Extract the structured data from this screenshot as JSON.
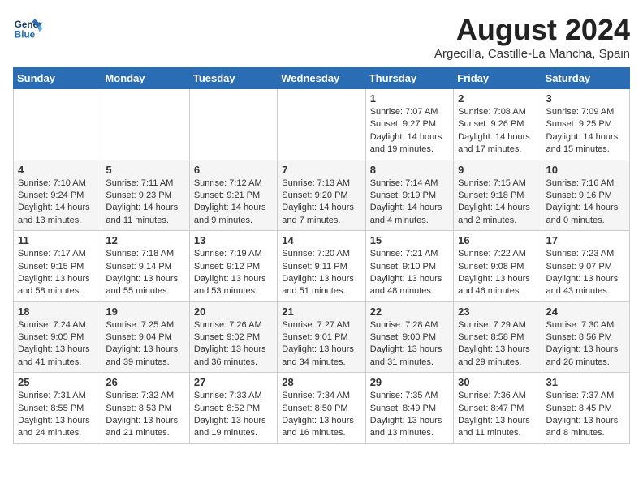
{
  "header": {
    "logo_line1": "General",
    "logo_line2": "Blue",
    "month_year": "August 2024",
    "location": "Argecilla, Castille-La Mancha, Spain"
  },
  "weekdays": [
    "Sunday",
    "Monday",
    "Tuesday",
    "Wednesday",
    "Thursday",
    "Friday",
    "Saturday"
  ],
  "weeks": [
    [
      {
        "day": "",
        "info": ""
      },
      {
        "day": "",
        "info": ""
      },
      {
        "day": "",
        "info": ""
      },
      {
        "day": "",
        "info": ""
      },
      {
        "day": "1",
        "info": "Sunrise: 7:07 AM\nSunset: 9:27 PM\nDaylight: 14 hours\nand 19 minutes."
      },
      {
        "day": "2",
        "info": "Sunrise: 7:08 AM\nSunset: 9:26 PM\nDaylight: 14 hours\nand 17 minutes."
      },
      {
        "day": "3",
        "info": "Sunrise: 7:09 AM\nSunset: 9:25 PM\nDaylight: 14 hours\nand 15 minutes."
      }
    ],
    [
      {
        "day": "4",
        "info": "Sunrise: 7:10 AM\nSunset: 9:24 PM\nDaylight: 14 hours\nand 13 minutes."
      },
      {
        "day": "5",
        "info": "Sunrise: 7:11 AM\nSunset: 9:23 PM\nDaylight: 14 hours\nand 11 minutes."
      },
      {
        "day": "6",
        "info": "Sunrise: 7:12 AM\nSunset: 9:21 PM\nDaylight: 14 hours\nand 9 minutes."
      },
      {
        "day": "7",
        "info": "Sunrise: 7:13 AM\nSunset: 9:20 PM\nDaylight: 14 hours\nand 7 minutes."
      },
      {
        "day": "8",
        "info": "Sunrise: 7:14 AM\nSunset: 9:19 PM\nDaylight: 14 hours\nand 4 minutes."
      },
      {
        "day": "9",
        "info": "Sunrise: 7:15 AM\nSunset: 9:18 PM\nDaylight: 14 hours\nand 2 minutes."
      },
      {
        "day": "10",
        "info": "Sunrise: 7:16 AM\nSunset: 9:16 PM\nDaylight: 14 hours\nand 0 minutes."
      }
    ],
    [
      {
        "day": "11",
        "info": "Sunrise: 7:17 AM\nSunset: 9:15 PM\nDaylight: 13 hours\nand 58 minutes."
      },
      {
        "day": "12",
        "info": "Sunrise: 7:18 AM\nSunset: 9:14 PM\nDaylight: 13 hours\nand 55 minutes."
      },
      {
        "day": "13",
        "info": "Sunrise: 7:19 AM\nSunset: 9:12 PM\nDaylight: 13 hours\nand 53 minutes."
      },
      {
        "day": "14",
        "info": "Sunrise: 7:20 AM\nSunset: 9:11 PM\nDaylight: 13 hours\nand 51 minutes."
      },
      {
        "day": "15",
        "info": "Sunrise: 7:21 AM\nSunset: 9:10 PM\nDaylight: 13 hours\nand 48 minutes."
      },
      {
        "day": "16",
        "info": "Sunrise: 7:22 AM\nSunset: 9:08 PM\nDaylight: 13 hours\nand 46 minutes."
      },
      {
        "day": "17",
        "info": "Sunrise: 7:23 AM\nSunset: 9:07 PM\nDaylight: 13 hours\nand 43 minutes."
      }
    ],
    [
      {
        "day": "18",
        "info": "Sunrise: 7:24 AM\nSunset: 9:05 PM\nDaylight: 13 hours\nand 41 minutes."
      },
      {
        "day": "19",
        "info": "Sunrise: 7:25 AM\nSunset: 9:04 PM\nDaylight: 13 hours\nand 39 minutes."
      },
      {
        "day": "20",
        "info": "Sunrise: 7:26 AM\nSunset: 9:02 PM\nDaylight: 13 hours\nand 36 minutes."
      },
      {
        "day": "21",
        "info": "Sunrise: 7:27 AM\nSunset: 9:01 PM\nDaylight: 13 hours\nand 34 minutes."
      },
      {
        "day": "22",
        "info": "Sunrise: 7:28 AM\nSunset: 9:00 PM\nDaylight: 13 hours\nand 31 minutes."
      },
      {
        "day": "23",
        "info": "Sunrise: 7:29 AM\nSunset: 8:58 PM\nDaylight: 13 hours\nand 29 minutes."
      },
      {
        "day": "24",
        "info": "Sunrise: 7:30 AM\nSunset: 8:56 PM\nDaylight: 13 hours\nand 26 minutes."
      }
    ],
    [
      {
        "day": "25",
        "info": "Sunrise: 7:31 AM\nSunset: 8:55 PM\nDaylight: 13 hours\nand 24 minutes."
      },
      {
        "day": "26",
        "info": "Sunrise: 7:32 AM\nSunset: 8:53 PM\nDaylight: 13 hours\nand 21 minutes."
      },
      {
        "day": "27",
        "info": "Sunrise: 7:33 AM\nSunset: 8:52 PM\nDaylight: 13 hours\nand 19 minutes."
      },
      {
        "day": "28",
        "info": "Sunrise: 7:34 AM\nSunset: 8:50 PM\nDaylight: 13 hours\nand 16 minutes."
      },
      {
        "day": "29",
        "info": "Sunrise: 7:35 AM\nSunset: 8:49 PM\nDaylight: 13 hours\nand 13 minutes."
      },
      {
        "day": "30",
        "info": "Sunrise: 7:36 AM\nSunset: 8:47 PM\nDaylight: 13 hours\nand 11 minutes."
      },
      {
        "day": "31",
        "info": "Sunrise: 7:37 AM\nSunset: 8:45 PM\nDaylight: 13 hours\nand 8 minutes."
      }
    ]
  ]
}
